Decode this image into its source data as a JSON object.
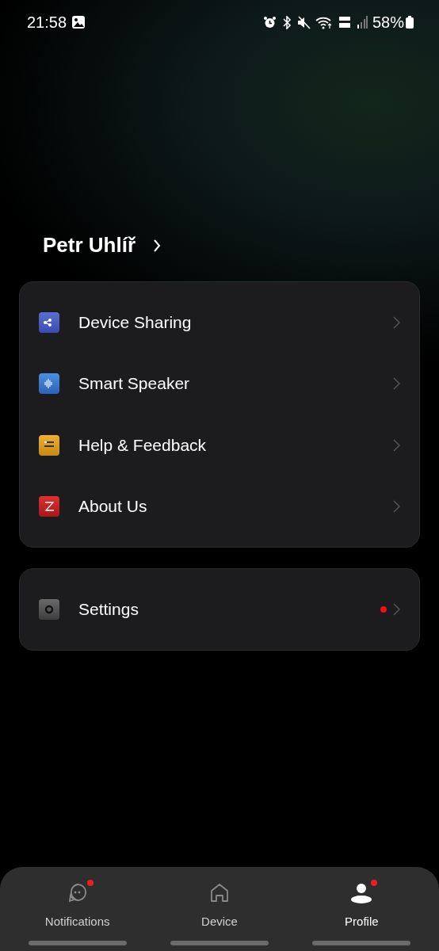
{
  "status_bar": {
    "time": "21:58",
    "battery": "58%"
  },
  "profile": {
    "name": "Petr Uhlíř"
  },
  "menu_groups": [
    {
      "items": [
        {
          "label": "Device Sharing",
          "kind": "share",
          "badge": false
        },
        {
          "label": "Smart Speaker",
          "kind": "speaker",
          "badge": false
        },
        {
          "label": "Help & Feedback",
          "kind": "help",
          "badge": false
        },
        {
          "label": "About Us",
          "kind": "about",
          "badge": false
        }
      ]
    },
    {
      "items": [
        {
          "label": "Settings",
          "kind": "settings",
          "badge": true
        }
      ]
    }
  ],
  "tabs": [
    {
      "label": "Notifications",
      "kind": "chat",
      "selected": false,
      "badge": true
    },
    {
      "label": "Device",
      "kind": "home",
      "selected": false,
      "badge": false
    },
    {
      "label": "Profile",
      "kind": "person",
      "selected": true,
      "badge": true
    }
  ]
}
